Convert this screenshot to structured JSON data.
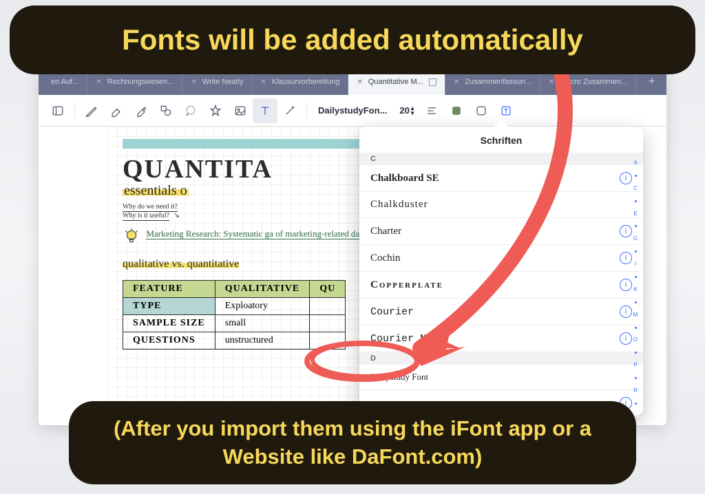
{
  "banners": {
    "top": "Fonts will be added automatically",
    "bottom": "(After you import them using the iFont app or a Website like DaFont.com)"
  },
  "tabs": [
    {
      "label": "en Auf..."
    },
    {
      "label": "Rechnungswesen..."
    },
    {
      "label": "Write Neatly"
    },
    {
      "label": "Klausurvorbereitung"
    },
    {
      "label": "Quantitative M..."
    },
    {
      "label": "Zusammenfassun..."
    },
    {
      "label": "Macro Zusammen..."
    }
  ],
  "toolbar": {
    "font_name": "DailystudyFon...",
    "font_size": "20"
  },
  "document": {
    "title": "QUANTITA",
    "subtitle": "essentials o",
    "aside1": "Why do we need it?",
    "aside2": "Why is it useful?",
    "para": "Marketing Research: Systematic ga of marketing-related data → prod information → decision-making",
    "comparison": "qualitative vs. quantitative",
    "table": {
      "headers": [
        "FEATURE",
        "QUALITATIVE",
        "QU"
      ],
      "rows": [
        [
          "TYPE",
          "Exploatory",
          ""
        ],
        [
          "SAMPLE SIZE",
          "small",
          ""
        ],
        [
          "QUESTIONS",
          "unstructured",
          ""
        ]
      ]
    }
  },
  "popover": {
    "title": "Schriften",
    "section_c": "C",
    "section_d": "D",
    "fonts_c": [
      "Chalkboard SE",
      "Chalkduster",
      "Charter",
      "Cochin",
      "Copperplate",
      "Courier",
      "Courier New"
    ],
    "fonts_d": [
      "Dailystudy Font"
    ],
    "index": [
      "A",
      "•",
      "C",
      "•",
      "E",
      "•",
      "G",
      "•",
      "I",
      "•",
      "K",
      "•",
      "M",
      "•",
      "O",
      "•",
      "P",
      "•",
      "R",
      "•"
    ]
  }
}
